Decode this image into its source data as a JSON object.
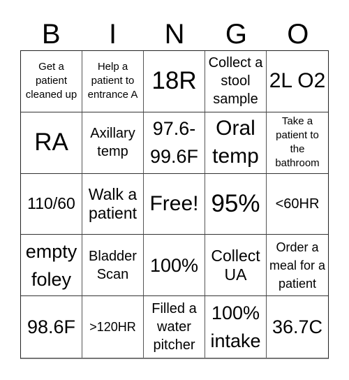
{
  "header": {
    "letters": [
      "B",
      "I",
      "N",
      "G",
      "O"
    ]
  },
  "grid": {
    "cells": [
      "Get a patient cleaned up",
      "Help a patient to entrance A",
      "18R",
      "Collect a stool sample",
      "2L O2",
      "RA",
      "Axillary temp",
      "97.6-99.6F",
      "Oral temp",
      "Take a patient to the bathroom",
      "110/60",
      "Walk a patient",
      "Free!",
      "95%",
      "<60HR",
      "empty foley",
      "Bladder Scan",
      "100%",
      "Collect UA",
      "Order a meal for a patient",
      "98.6F",
      ">120HR",
      "Filled a water pitcher",
      "100% intake",
      "36.7C"
    ]
  }
}
